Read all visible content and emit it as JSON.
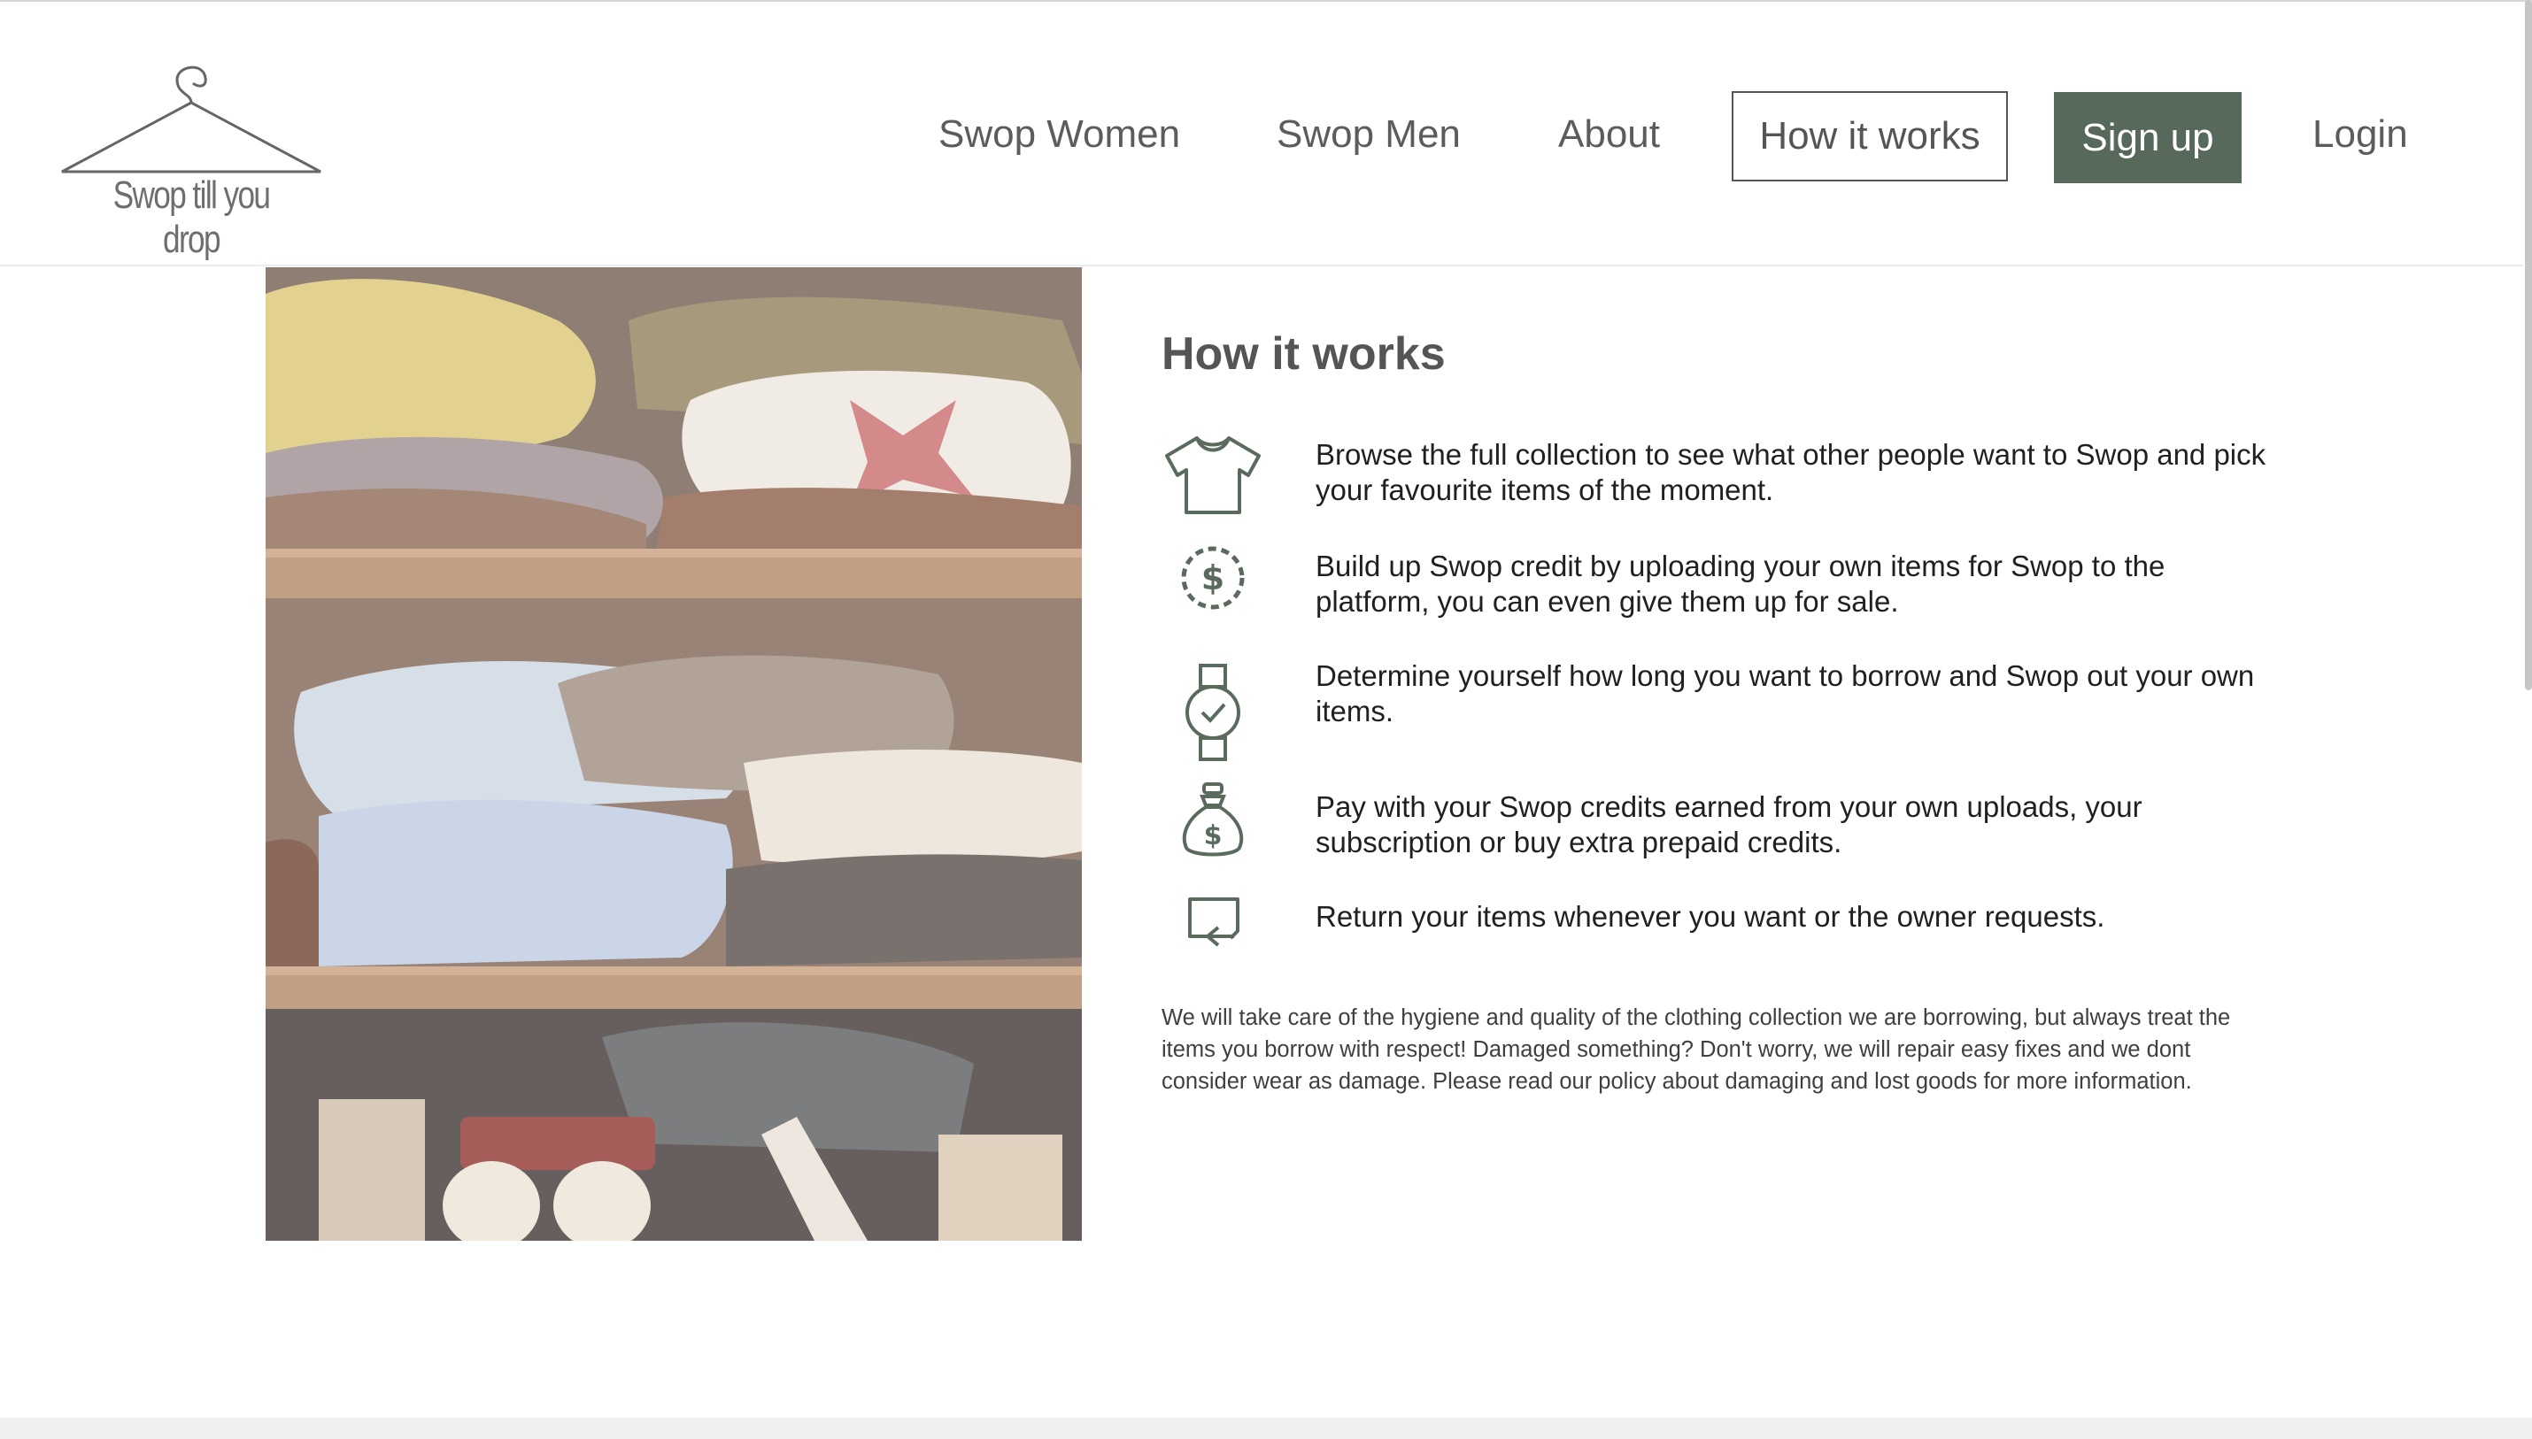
{
  "header": {
    "logo_text": "Swop till you drop",
    "nav": {
      "women": "Swop Women",
      "men": "Swop Men",
      "about": "About",
      "how_it_works": "How it works",
      "sign_up": "Sign up",
      "login": "Login"
    }
  },
  "main": {
    "title": "How it works",
    "image_alt": "Wardrobe shelves with folded clothes",
    "steps": [
      {
        "icon": "t-shirt-icon",
        "text": "Browse the full collection to see what other people want to Swop and pick your favourite items of the moment."
      },
      {
        "icon": "dollar-coin-icon",
        "text": "Build up Swop credit by uploading your own items for Swop to the platform, you can even give them up for sale."
      },
      {
        "icon": "wristwatch-icon",
        "text": "Determine yourself how long you want to borrow and Swop out your own items."
      },
      {
        "icon": "money-bag-icon",
        "text": "Pay with your Swop credits earned from your own uploads, your subscription or buy extra prepaid credits."
      },
      {
        "icon": "return-arrow-icon",
        "text": "Return your items whenever you want or the owner requests."
      }
    ],
    "note": "We will take care of the hygiene and quality of the clothing collection we are borrowing, but always treat the items you borrow with respect! Damaged something? Don't worry, we will repair easy fixes and we dont consider wear as damage. Please read our policy about damaging and lost goods for more information."
  },
  "colors": {
    "accent": "#56695a",
    "icon": "#5a6b5d",
    "text": "#202020"
  }
}
